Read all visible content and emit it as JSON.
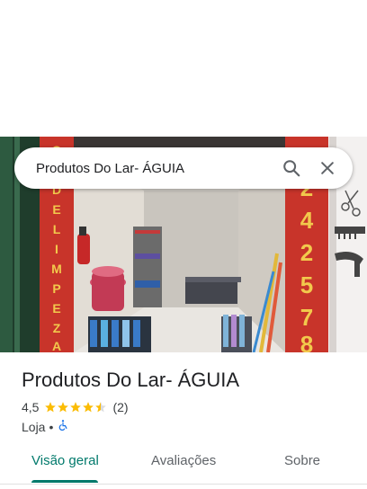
{
  "search": {
    "query": "Produtos Do Lar- ÁGUIA",
    "search_icon": "search-icon",
    "close_icon": "close-icon"
  },
  "photo": {
    "left_sign_text": "PRODUTOS DE LIMPEZA ÁGUIA",
    "right_sign_text": "24-2578"
  },
  "place": {
    "name": "Produtos Do Lar- ÁGUIA",
    "rating": "4,5",
    "stars": 4.5,
    "review_count": "(2)",
    "category": "Loja",
    "separator": "•",
    "accessibility_icon": "wheelchair-icon"
  },
  "tabs": [
    {
      "label": "Visão geral",
      "active": true
    },
    {
      "label": "Avaliações",
      "active": false
    },
    {
      "label": "Sobre",
      "active": false
    }
  ],
  "colors": {
    "accent": "#00796b",
    "star": "#fbbc04",
    "accessibility": "#1a73e8"
  }
}
